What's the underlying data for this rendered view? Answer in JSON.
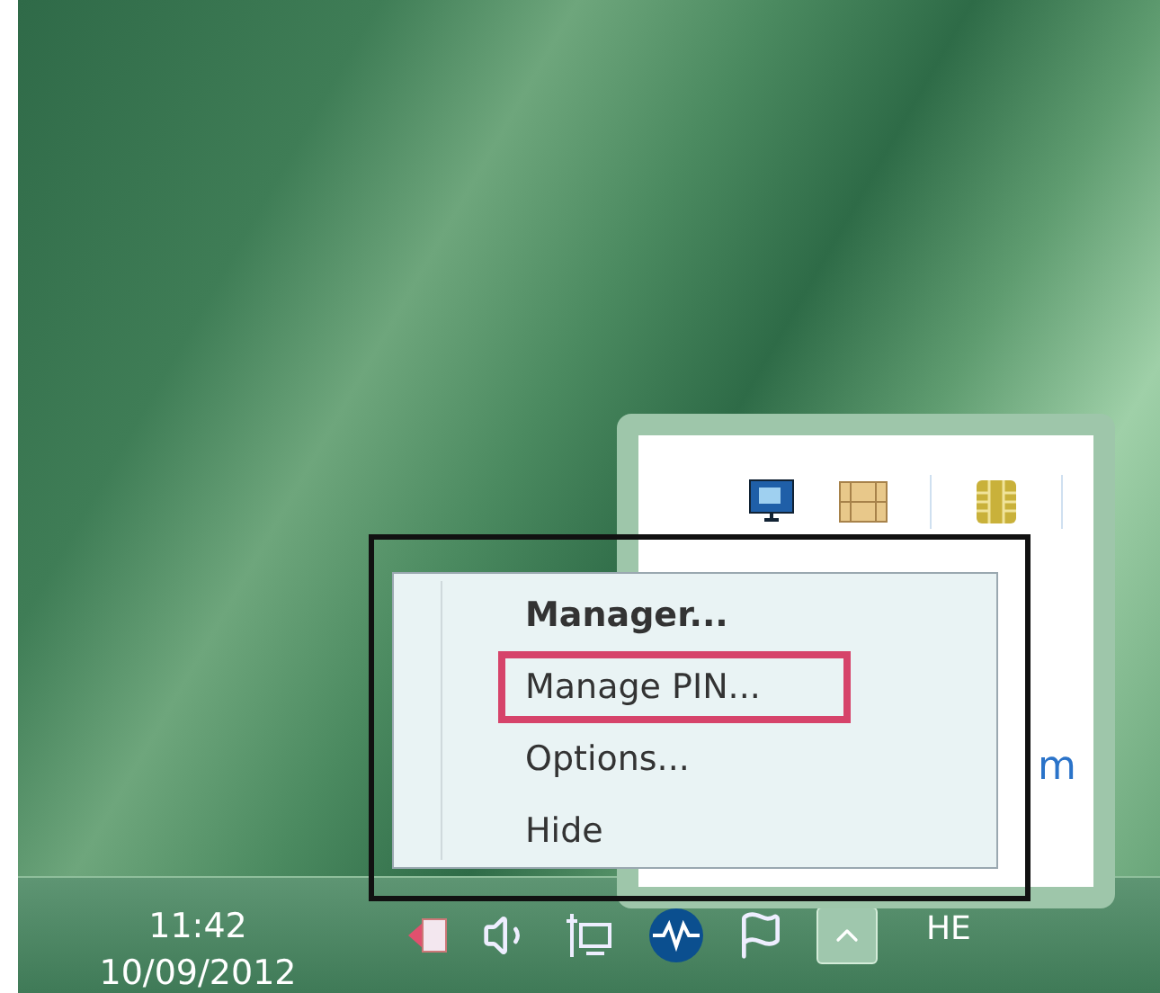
{
  "tray_overflow": {
    "link_fragment": "m"
  },
  "context_menu": {
    "items": [
      {
        "label": "Manager...",
        "default": true,
        "annotated": false
      },
      {
        "label": "Manage PIN...",
        "default": false,
        "annotated": true
      },
      {
        "label": "Options...",
        "default": false,
        "annotated": false
      },
      {
        "label": "Hide",
        "default": false,
        "annotated": false
      }
    ]
  },
  "taskbar": {
    "time": "11:42",
    "date": "10/09/2012",
    "language": "HE"
  }
}
